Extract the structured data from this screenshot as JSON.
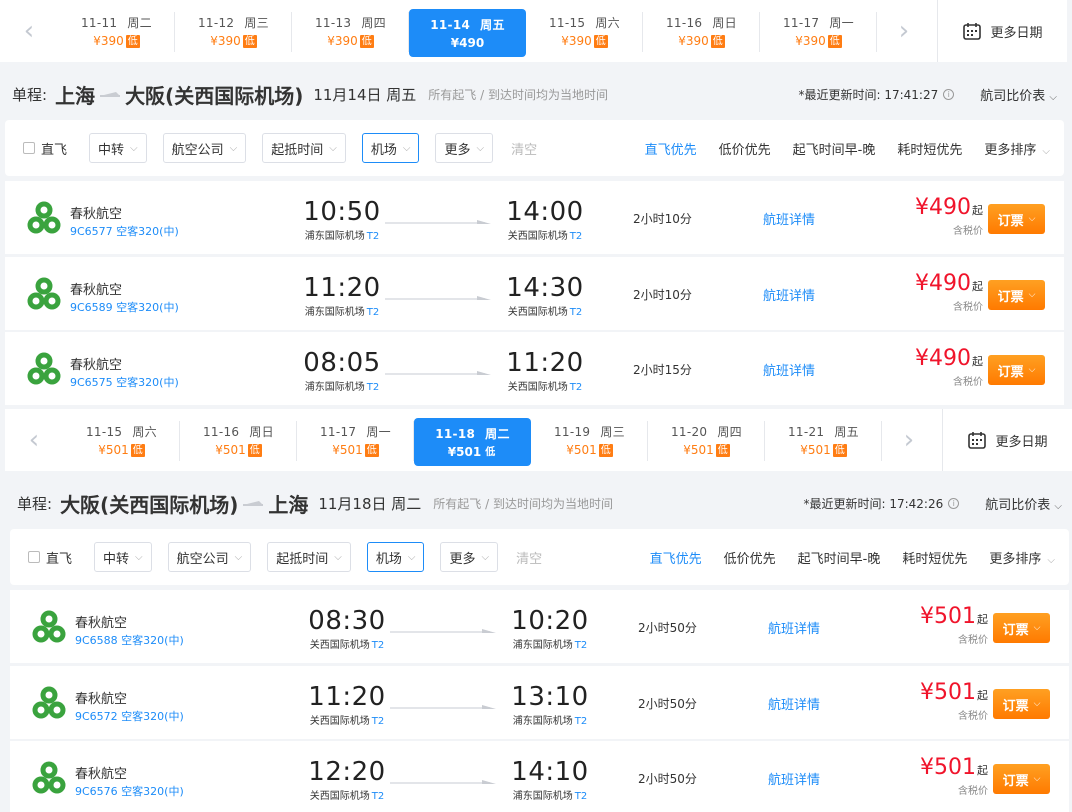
{
  "sections": [
    {
      "dates": [
        {
          "date": "11-11",
          "weekday": "周二",
          "price": "¥390",
          "low": "低"
        },
        {
          "date": "11-12",
          "weekday": "周三",
          "price": "¥390",
          "low": "低"
        },
        {
          "date": "11-13",
          "weekday": "周四",
          "price": "¥390",
          "low": "低"
        },
        {
          "date": "11-14",
          "weekday": "周五",
          "price": "¥490",
          "low": ""
        },
        {
          "date": "11-15",
          "weekday": "周六",
          "price": "¥390",
          "low": "低"
        },
        {
          "date": "11-16",
          "weekday": "周日",
          "price": "¥390",
          "low": "低"
        },
        {
          "date": "11-17",
          "weekday": "周一",
          "price": "¥390",
          "low": "低"
        }
      ],
      "more_dates": "更多日期",
      "trip_label": "单程:",
      "from": "上海",
      "to": "大阪(关西国际机场)",
      "trip_date": "11月14日 周五",
      "note": "所有起飞 / 到达时间均为当地时间",
      "update": "*最近更新时间: 17:41:27",
      "compare": "航司比价表",
      "flights": [
        {
          "airline": "春秋航空",
          "flight_no": "9C6577 空客320(中)",
          "dep_time": "10:50",
          "dep_airport": "浦东国际机场",
          "dep_term": "T2",
          "arr_time": "14:00",
          "arr_airport": "关西国际机场",
          "arr_term": "T2",
          "duration": "2小时10分",
          "price": "¥490"
        },
        {
          "airline": "春秋航空",
          "flight_no": "9C6589 空客320(中)",
          "dep_time": "11:20",
          "dep_airport": "浦东国际机场",
          "dep_term": "T2",
          "arr_time": "14:30",
          "arr_airport": "关西国际机场",
          "arr_term": "T2",
          "duration": "2小时10分",
          "price": "¥490"
        },
        {
          "airline": "春秋航空",
          "flight_no": "9C6575 空客320(中)",
          "dep_time": "08:05",
          "dep_airport": "浦东国际机场",
          "dep_term": "T2",
          "arr_time": "11:20",
          "arr_airport": "关西国际机场",
          "arr_term": "T2",
          "duration": "2小时15分",
          "price": "¥490"
        }
      ]
    },
    {
      "dates": [
        {
          "date": "11-15",
          "weekday": "周六",
          "price": "¥501",
          "low": "低"
        },
        {
          "date": "11-16",
          "weekday": "周日",
          "price": "¥501",
          "low": "低"
        },
        {
          "date": "11-17",
          "weekday": "周一",
          "price": "¥501",
          "low": "低"
        },
        {
          "date": "11-18",
          "weekday": "周二",
          "price": "¥501",
          "low": "低"
        },
        {
          "date": "11-19",
          "weekday": "周三",
          "price": "¥501",
          "low": "低"
        },
        {
          "date": "11-20",
          "weekday": "周四",
          "price": "¥501",
          "low": "低"
        },
        {
          "date": "11-21",
          "weekday": "周五",
          "price": "¥501",
          "low": "低"
        }
      ],
      "more_dates": "更多日期",
      "trip_label": "单程:",
      "from": "大阪(关西国际机场)",
      "to": "上海",
      "trip_date": "11月18日 周二",
      "note": "所有起飞 / 到达时间均为当地时间",
      "update": "*最近更新时间: 17:42:26",
      "compare": "航司比价表",
      "flights": [
        {
          "airline": "春秋航空",
          "flight_no": "9C6588 空客320(中)",
          "dep_time": "08:30",
          "dep_airport": "关西国际机场",
          "dep_term": "T2",
          "arr_time": "10:20",
          "arr_airport": "浦东国际机场",
          "arr_term": "T2",
          "duration": "2小时50分",
          "price": "¥501"
        },
        {
          "airline": "春秋航空",
          "flight_no": "9C6572 空客320(中)",
          "dep_time": "11:20",
          "dep_airport": "关西国际机场",
          "dep_term": "T2",
          "arr_time": "13:10",
          "arr_airport": "浦东国际机场",
          "arr_term": "T2",
          "duration": "2小时50分",
          "price": "¥501"
        },
        {
          "airline": "春秋航空",
          "flight_no": "9C6576 空客320(中)",
          "dep_time": "12:20",
          "dep_airport": "关西国际机场",
          "dep_term": "T2",
          "arr_time": "14:10",
          "arr_airport": "浦东国际机场",
          "arr_term": "T2",
          "duration": "2小时50分",
          "price": "¥501"
        }
      ]
    }
  ],
  "filters": {
    "direct": "直飞",
    "transfer": "中转",
    "airline": "航空公司",
    "time": "起抵时间",
    "airport": "机场",
    "more": "更多",
    "clear": "清空"
  },
  "sort": {
    "direct_first": "直飞优先",
    "low_price": "低价优先",
    "dep_early": "起飞时间早-晚",
    "short_time": "耗时短优先",
    "more": "更多排序"
  },
  "labels": {
    "price_suffix": "起",
    "tax": "含税价",
    "detail": "航班详情",
    "book": "订票"
  },
  "colors": {
    "accent": "#1d8cf8",
    "price_red": "#f0142b",
    "low_orange": "#ff7d13",
    "airline_green": "#3aa33e",
    "book_orange": "#ff8a00"
  },
  "icons": [
    "chevron-left-icon",
    "chevron-right-icon",
    "calendar-icon",
    "plane-icon",
    "spring-airlines-logo",
    "info-icon",
    "chevron-down-icon"
  ]
}
